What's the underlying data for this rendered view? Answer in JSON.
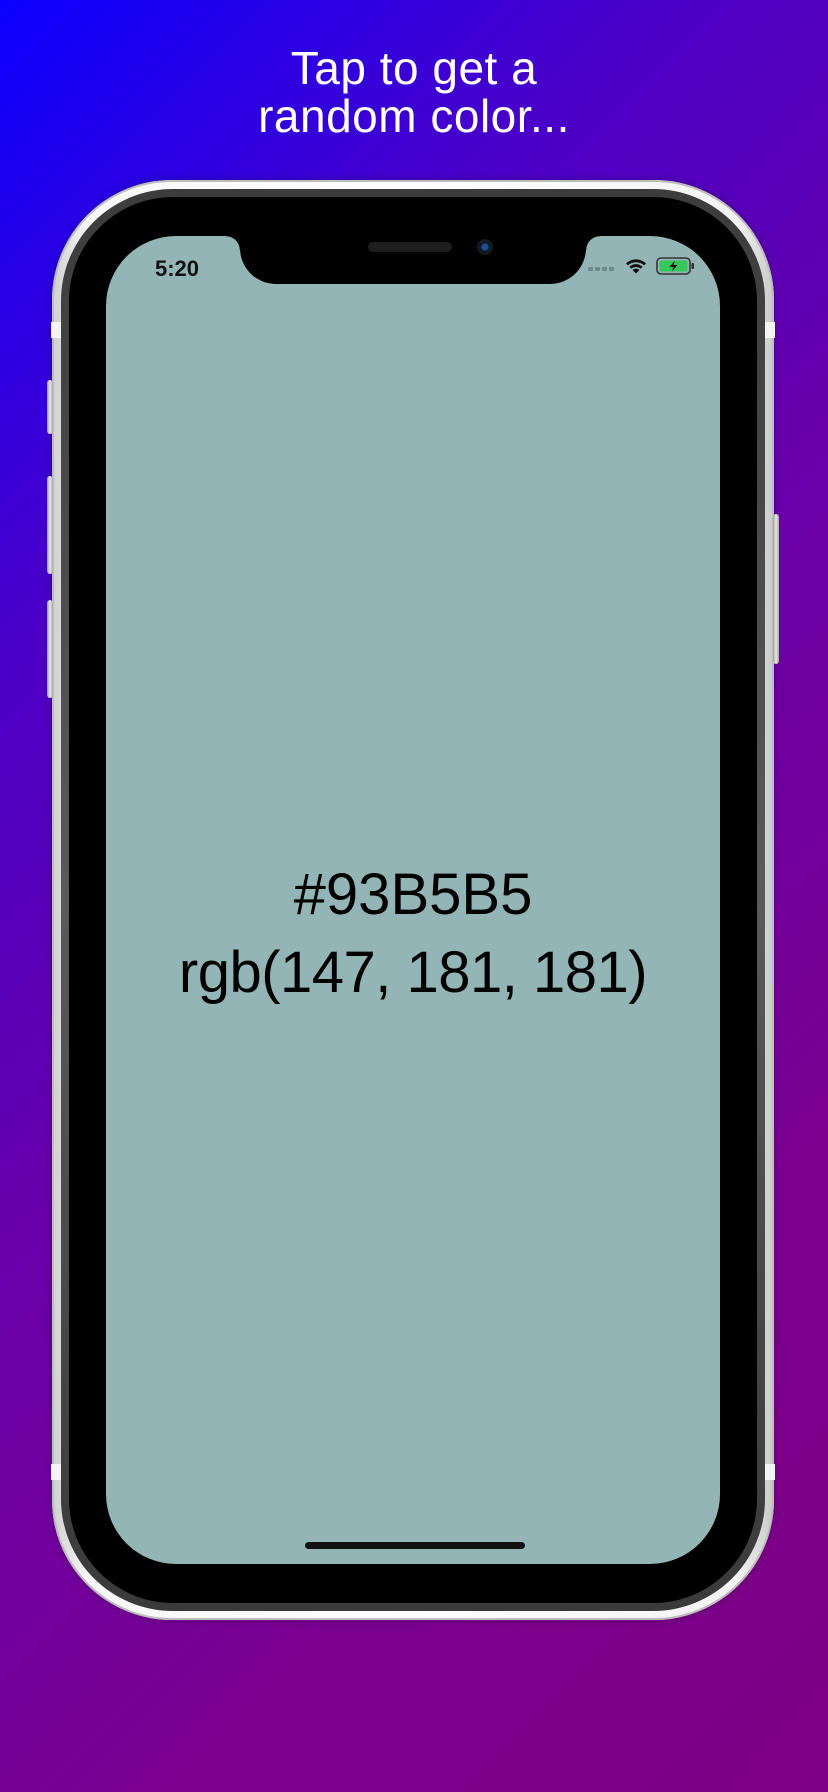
{
  "headline": {
    "line1": "Tap to get a",
    "line2": "random color..."
  },
  "status_bar": {
    "time": "5:20",
    "signal_icon": "cellular-signal-icon",
    "wifi_icon": "wifi-icon",
    "battery_icon": "battery-charging-icon"
  },
  "color_display": {
    "hex": "#93B5B5",
    "rgb": "rgb(147, 181, 181)",
    "swatch": "#93B5B5"
  },
  "colors": {
    "background_start": "#0a00ff",
    "background_end": "#7d0084",
    "headline_text": "#ffffff",
    "value_text": "#000000",
    "battery_fill": "#34c759"
  }
}
